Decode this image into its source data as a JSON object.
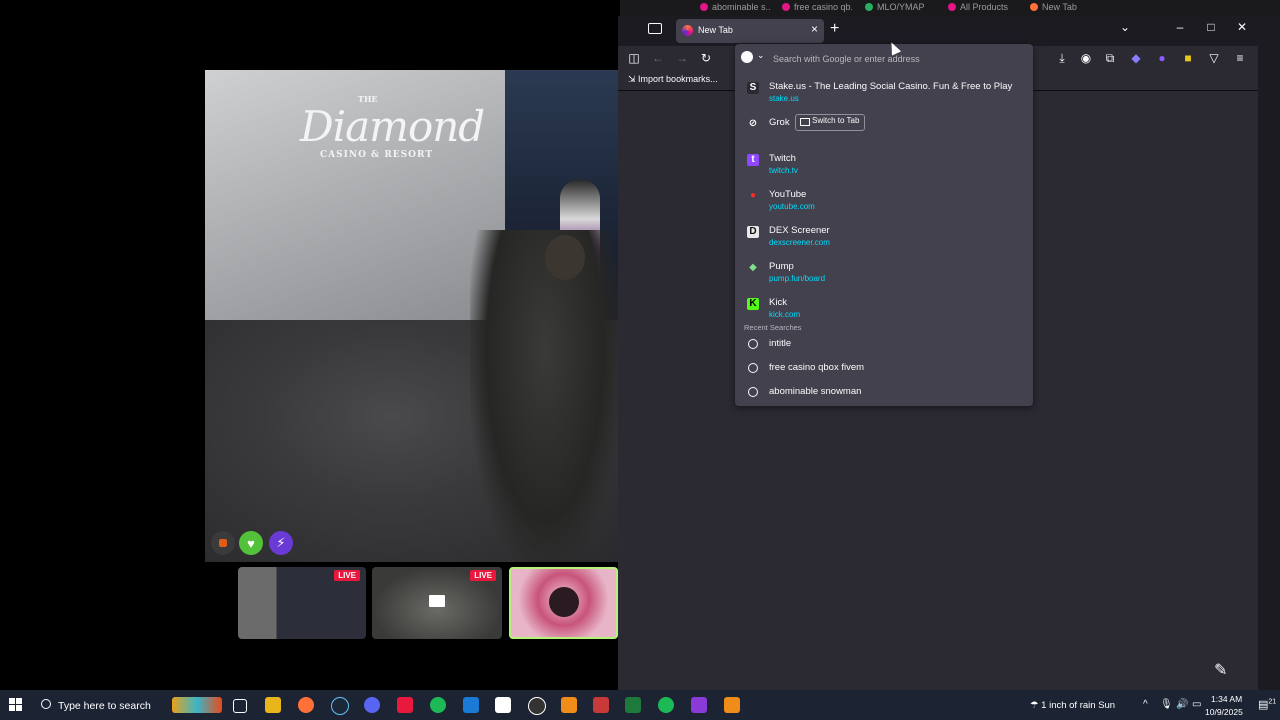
{
  "background_tabs": [
    "abominable s...",
    "free casino qb...",
    "MLO/YMAP",
    "All Products",
    "New Tab"
  ],
  "stream": {
    "logo_the": "THE",
    "logo_name": "Diamond",
    "logo_sub": "CASINO & RESORT",
    "thumbnails": [
      {
        "badge": "LIVE"
      },
      {
        "badge": "LIVE"
      },
      {
        "badge": ""
      }
    ]
  },
  "browser": {
    "active_tab": {
      "label": "New Tab"
    },
    "bookmarks_import": "Import bookmarks...",
    "urlbar": {
      "placeholder": "Search with Google or enter address",
      "value": ""
    },
    "suggestions": [
      {
        "title": "Stake.us - The Leading Social Casino. Fun & Free to Play",
        "url": "stake.us",
        "icon": "stake-icon",
        "icon_glyph": "S",
        "color": "#2b2a33"
      },
      {
        "title": "Grok",
        "url": "",
        "icon": "grok-icon",
        "icon_glyph": "⊘",
        "color": "#42414d",
        "action": "Switch to Tab"
      },
      {
        "title": "Twitch",
        "url": "twitch.tv",
        "icon": "twitch-icon",
        "icon_glyph": "t",
        "color": "#9146ff"
      },
      {
        "title": "YouTube",
        "url": "youtube.com",
        "icon": "youtube-icon",
        "icon_glyph": "●",
        "color": "#42414d"
      },
      {
        "title": "DEX Screener",
        "url": "dexscreener.com",
        "icon": "dexscreener-icon",
        "icon_glyph": "D",
        "color": "#2b2a33"
      },
      {
        "title": "Pump",
        "url": "pump.fun/board",
        "icon": "pump-icon",
        "icon_glyph": "◆",
        "color": "#42414d"
      },
      {
        "title": "Kick",
        "url": "kick.com",
        "icon": "kick-icon",
        "icon_glyph": "K",
        "color": "#53fc18"
      }
    ],
    "recent_header": "Recent Searches",
    "recent_searches": [
      "intitle",
      "free casino qbox fivem",
      "abominable snowman"
    ]
  },
  "taskbar": {
    "search_label": "Type here to search",
    "weather": "1 inch of rain Sun",
    "time": "1:34 AM",
    "date": "10/9/2025",
    "notification_count": "21"
  },
  "colors": {
    "accent": "#00ddff",
    "live": "#e8193c",
    "panel": "#42414d"
  }
}
